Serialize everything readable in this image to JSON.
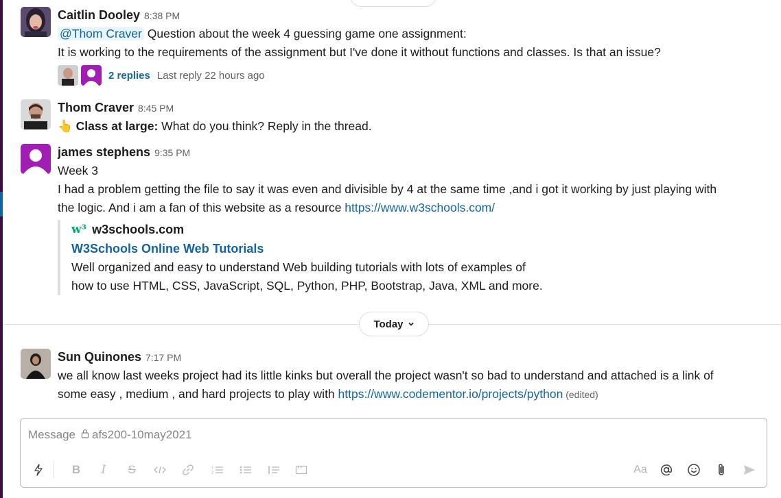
{
  "messages": {
    "caitlin": {
      "name": "Caitlin Dooley",
      "time": "8:38 PM",
      "mention": "@Thom Craver",
      "line1_rest": " Question about the week 4 guessing game one assignment:",
      "line2": "It is working to the requirements of the assignment but I've done it without functions and classes. Is that an issue?",
      "replies": "2 replies",
      "last_reply": "Last reply 22 hours ago"
    },
    "thom": {
      "name": "Thom Craver",
      "time": "8:45 PM",
      "emoji": "👆",
      "bold_text": "Class at large:",
      "rest_text": " What do you think? Reply in the thread."
    },
    "james": {
      "name": "james stephens",
      "time": "9:35 PM",
      "line1": "Week 3",
      "line2": "I had a problem getting the file to say it was even and divisible by 4 at the same time ,and i got it working by just playing with",
      "line3_text": "the logic. And i am a fan of this website as a resource ",
      "line3_link": "https://www.w3schools.com/",
      "unfurl": {
        "logo": "w³",
        "site": "w3schools.com",
        "title": "W3Schools Online Web Tutorials",
        "desc1": "Well organized and easy to understand Web building tutorials with lots of examples of",
        "desc2": "how to use HTML, CSS, JavaScript, SQL, Python, PHP, Bootstrap, Java, XML and more."
      }
    },
    "sun": {
      "name": "Sun Quinones",
      "time": "7:17 PM",
      "line1": "we all know last weeks project had its little kinks but overall the project wasn't so bad to understand and attached is a link of",
      "line2_text": "some easy , medium , and hard projects to play with ",
      "line2_link": "https://www.codementor.io/projects/python",
      "edited": " (edited)"
    }
  },
  "day_divider": {
    "label": "Today"
  },
  "composer": {
    "placeholder_prefix": "Message",
    "channel": "afs200-10may2021"
  },
  "toolbar": {
    "text_style_label": "Aa"
  },
  "colors": {
    "link": "#1264a3",
    "sidebar": "#3f0e40",
    "w3_green": "#04aa6d"
  }
}
